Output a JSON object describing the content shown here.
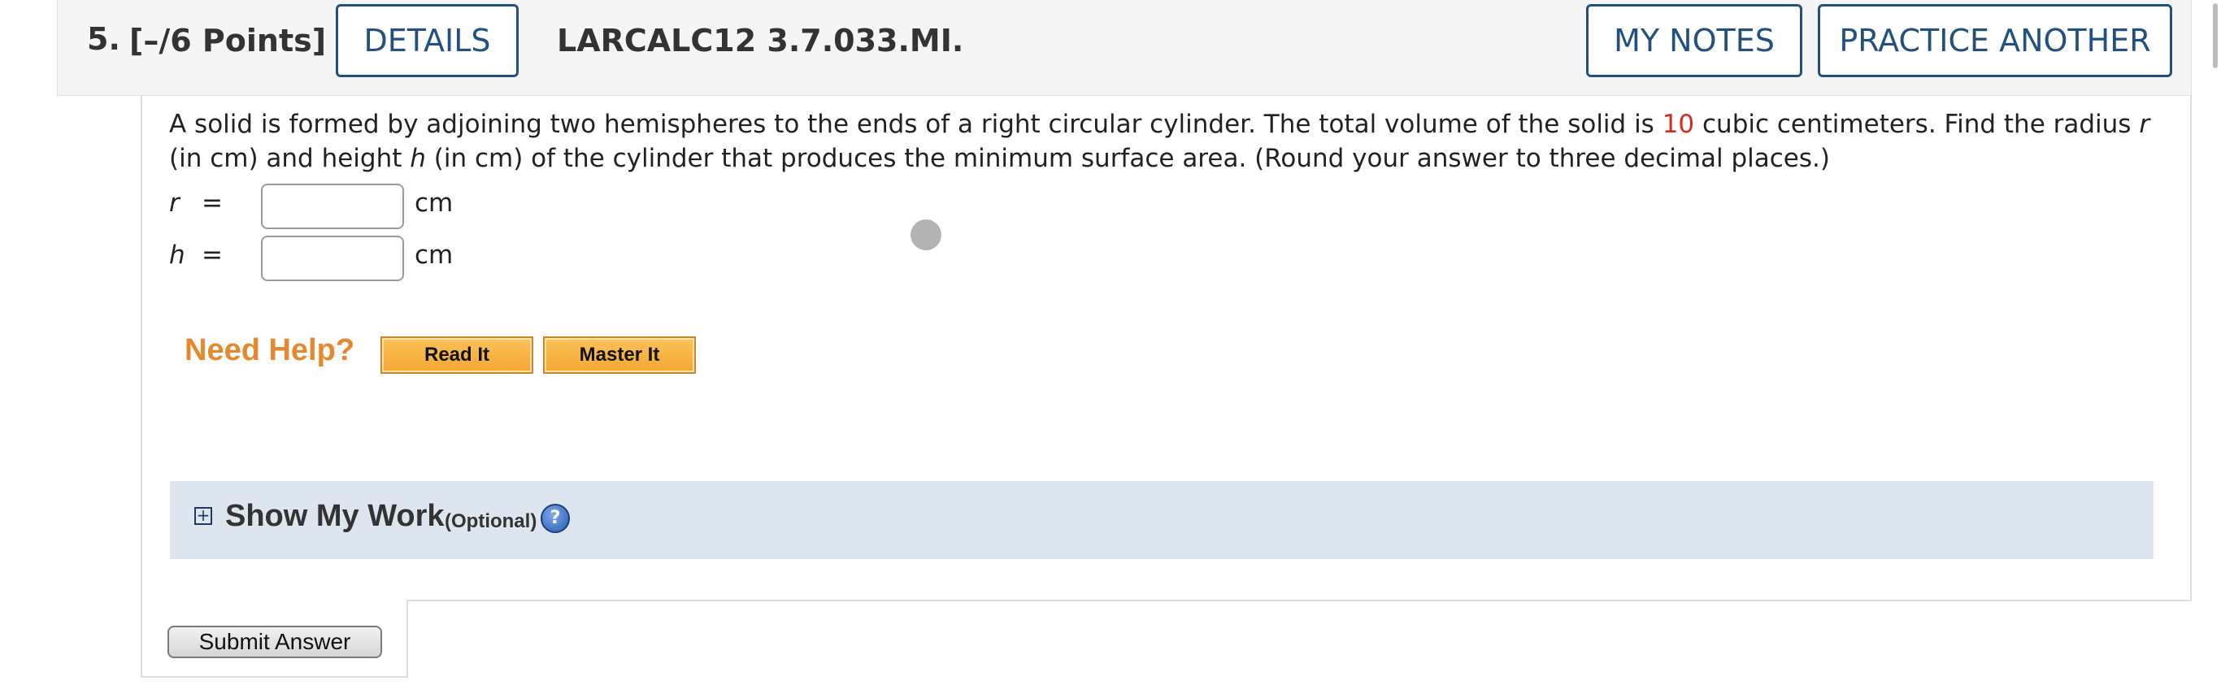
{
  "header": {
    "question_number": "5.",
    "points": "[–/6 Points]",
    "details_label": "DETAILS",
    "question_code": "LARCALC12 3.7.033.MI.",
    "my_notes_label": "MY NOTES",
    "practice_another_label": "PRACTICE ANOTHER"
  },
  "problem": {
    "text_1": "A solid is formed by adjoining two hemispheres to the ends of a right circular cylinder. The total volume of the solid is ",
    "volume_value": "10",
    "text_2": " cubic centimeters. Find the radius ",
    "var_r": "r",
    "text_3": " (in cm) and height ",
    "var_h": "h",
    "text_4": " (in cm) of the cylinder that produces the minimum surface area. (Round your answer to three decimal places.)"
  },
  "answers": [
    {
      "variable": "r",
      "equals": "=",
      "value": "",
      "unit": "cm"
    },
    {
      "variable": "h",
      "equals": "=",
      "value": "",
      "unit": "cm"
    }
  ],
  "help": {
    "title": "Need Help?",
    "read_it_label": "Read It",
    "master_it_label": "Master It"
  },
  "show_my_work": {
    "expand_symbol": "+",
    "title": "Show My Work",
    "optional": "(Optional)",
    "help_symbol": "?"
  },
  "submit": {
    "label": "Submit Answer"
  },
  "colors": {
    "accent_blue": "#22517f",
    "highlight_red": "#d52b1e",
    "need_help_orange": "#e5882e",
    "show_work_bg": "#dde6ef"
  }
}
